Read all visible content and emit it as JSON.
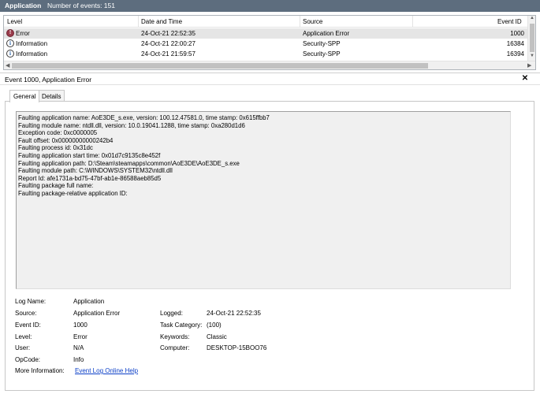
{
  "header": {
    "title": "Application",
    "count_text": "Number of events: 151"
  },
  "grid": {
    "columns": [
      "Level",
      "Date and Time",
      "Source",
      "Event ID"
    ],
    "rows": [
      {
        "level": "Error",
        "icon": "error-icon",
        "datetime": "24-Oct-21 22:52:35",
        "source": "Application Error",
        "event_id": "1000",
        "selected": true
      },
      {
        "level": "Information",
        "icon": "info-icon",
        "datetime": "24-Oct-21 22:00:27",
        "source": "Security-SPP",
        "event_id": "16384",
        "selected": false
      },
      {
        "level": "Information",
        "icon": "info-icon",
        "datetime": "24-Oct-21 21:59:57",
        "source": "Security-SPP",
        "event_id": "16394",
        "selected": false
      }
    ]
  },
  "detail": {
    "title": "Event 1000, Application Error",
    "close_label": "✕",
    "tabs": [
      {
        "label": "General",
        "active": true
      },
      {
        "label": "Details",
        "active": false
      }
    ],
    "description_lines": [
      "Faulting application name: AoE3DE_s.exe, version: 100.12.47581.0, time stamp: 0x615ffbb7",
      "Faulting module name: ntdll.dll, version: 10.0.19041.1288, time stamp: 0xa280d1d6",
      "Exception code: 0xc0000005",
      "Fault offset: 0x00000000000242b4",
      "Faulting process id: 0x31dc",
      "Faulting application start time: 0x01d7c9135c8e452f",
      "Faulting application path: D:\\Steam\\steamapps\\common\\AoE3DE\\AoE3DE_s.exe",
      "Faulting module path: C:\\WINDOWS\\SYSTEM32\\ntdll.dll",
      "Report Id: afe1731a-bd75-47bf-ab1e-86588aeb85d5",
      "Faulting package full name:",
      "Faulting package-relative application ID:"
    ],
    "props": {
      "log_name_label": "Log Name:",
      "log_name": "Application",
      "source_label": "Source:",
      "source": "Application Error",
      "logged_label": "Logged:",
      "logged": "24-Oct-21 22:52:35",
      "event_id_label": "Event ID:",
      "event_id": "1000",
      "task_label": "Task Category:",
      "task": "(100)",
      "level_label": "Level:",
      "level": "Error",
      "keywords_label": "Keywords:",
      "keywords": "Classic",
      "user_label": "User:",
      "user": "N/A",
      "computer_label": "Computer:",
      "computer": "DESKTOP-15BOO76",
      "opcode_label": "OpCode:",
      "opcode": "Info",
      "more_info_label": "More Information:",
      "more_info_link": "Event Log Online Help"
    }
  },
  "colors": {
    "titlebar": "#5d6d7e",
    "selected_row": "#e5e5e5",
    "link": "#0b3fc7",
    "error_icon": "#9a3b4b"
  }
}
